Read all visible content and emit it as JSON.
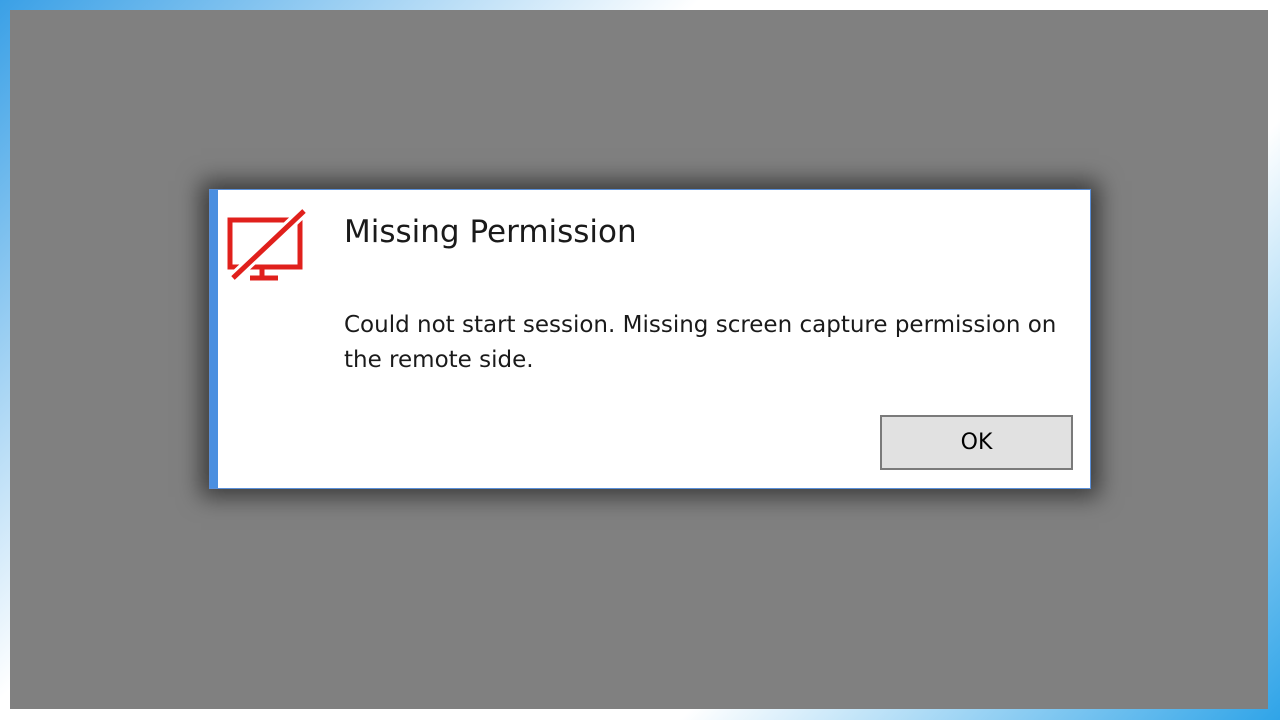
{
  "dialog": {
    "title": "Missing Permission",
    "message": "Could not start session. Missing screen capture permission on the remote side.",
    "icon": "monitor-slash-icon",
    "ok_label": "OK"
  },
  "colors": {
    "backdrop": "#808080",
    "dialog_background": "#ffffff",
    "accent": "#4a8fe0",
    "icon": "#e0201c",
    "button_background": "#e1e1e1",
    "button_border": "#7a7a7a"
  }
}
